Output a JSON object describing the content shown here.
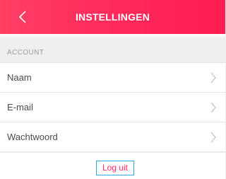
{
  "header": {
    "title": "INSTELLINGEN",
    "back_icon": "chevron-left-icon"
  },
  "section": {
    "label": "ACCOUNT"
  },
  "items": [
    {
      "label": "Naam",
      "icon": "chevron-right-icon"
    },
    {
      "label": "E-mail",
      "icon": "chevron-right-icon"
    },
    {
      "label": "Wachtwoord",
      "icon": "chevron-right-icon"
    }
  ],
  "logout": {
    "label": "Log uit"
  },
  "colors": {
    "accent": "#ff2a5c",
    "header_start": "#ff3f63",
    "header_end": "#ff1b4f",
    "focus": "#28a9e6",
    "background": "#efeff2"
  }
}
